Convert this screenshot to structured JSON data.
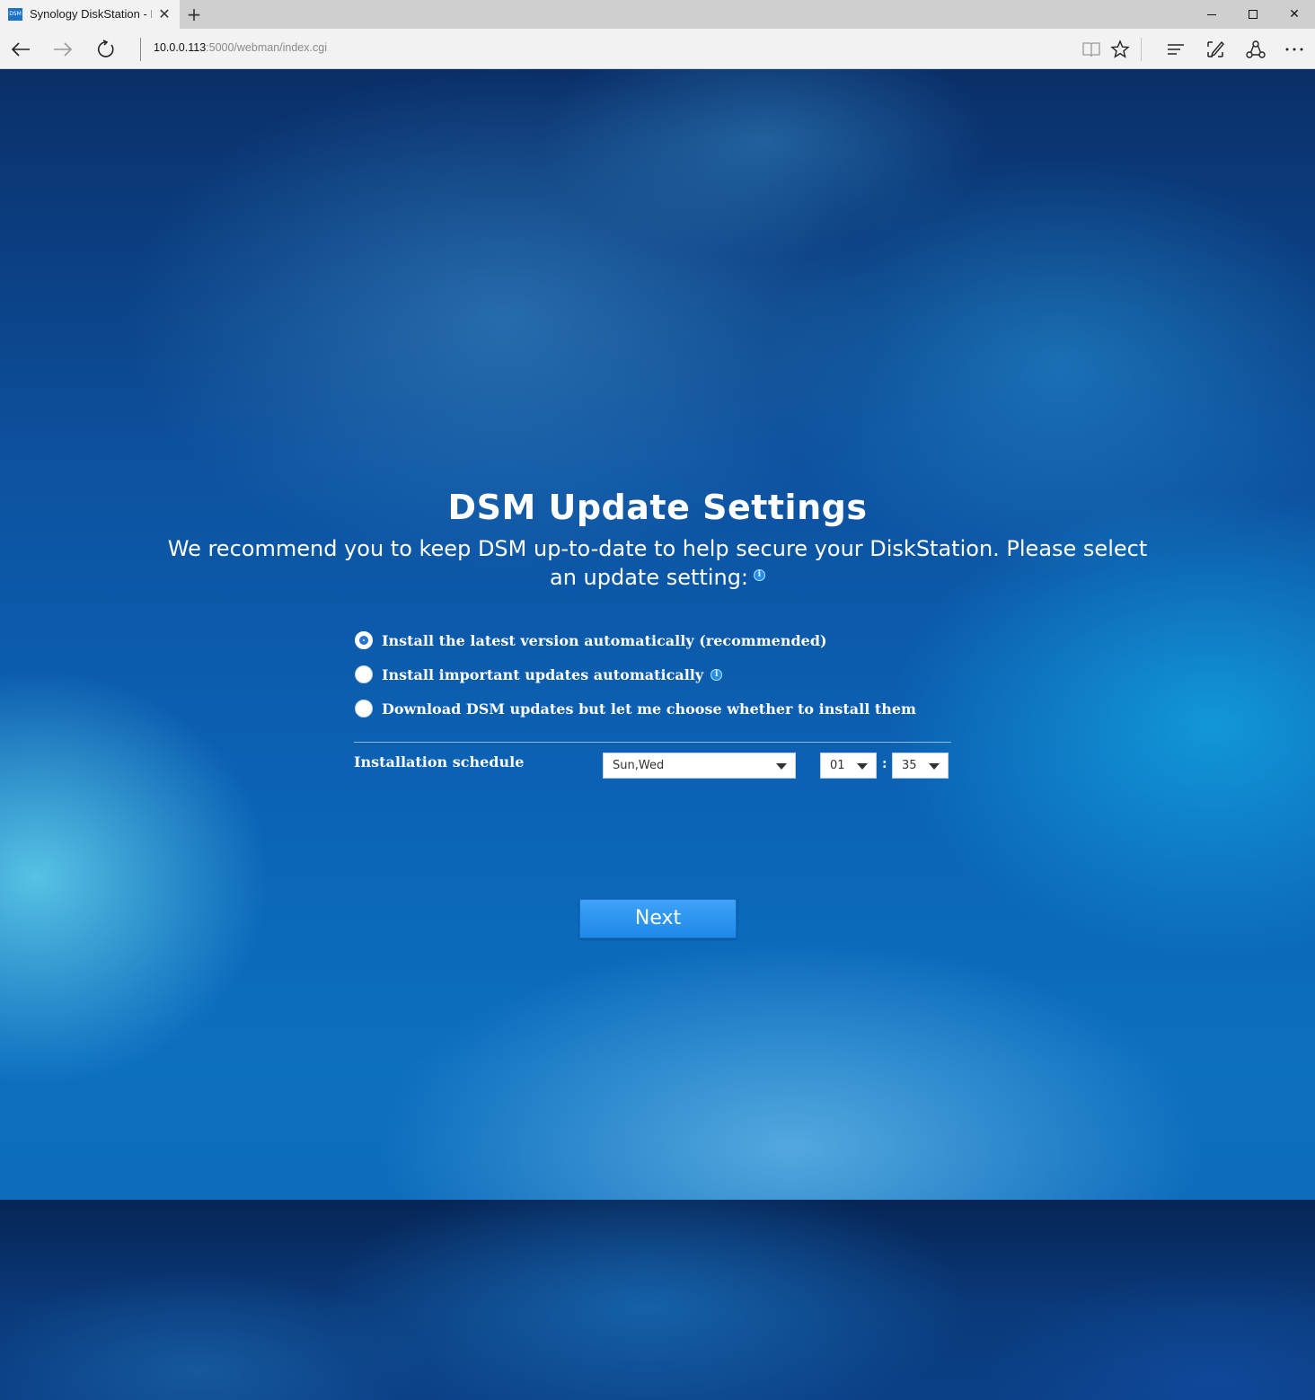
{
  "browser": {
    "tab_title": "Synology DiskStation - I",
    "favicon_text": "DSM",
    "url_host": "10.0.0.113",
    "url_path": ":5000/webman/index.cgi"
  },
  "page": {
    "title": "DSM Update Settings",
    "subtitle": "We recommend you to keep DSM up-to-date to help secure your DiskStation. Please select an update setting:",
    "options": [
      {
        "label": "Install the latest version automatically (recommended)",
        "checked": true
      },
      {
        "label": "Install important updates automatically",
        "checked": false,
        "info": true
      },
      {
        "label": "Download DSM updates but let me choose whether to install them",
        "checked": false
      }
    ],
    "schedule": {
      "label": "Installation schedule",
      "days": "Sun,Wed",
      "hour": "01",
      "separator": ":",
      "minute": "35"
    },
    "next_label": "Next"
  },
  "colors": {
    "accent": "#1d89ea",
    "background": "#0d52a0"
  }
}
